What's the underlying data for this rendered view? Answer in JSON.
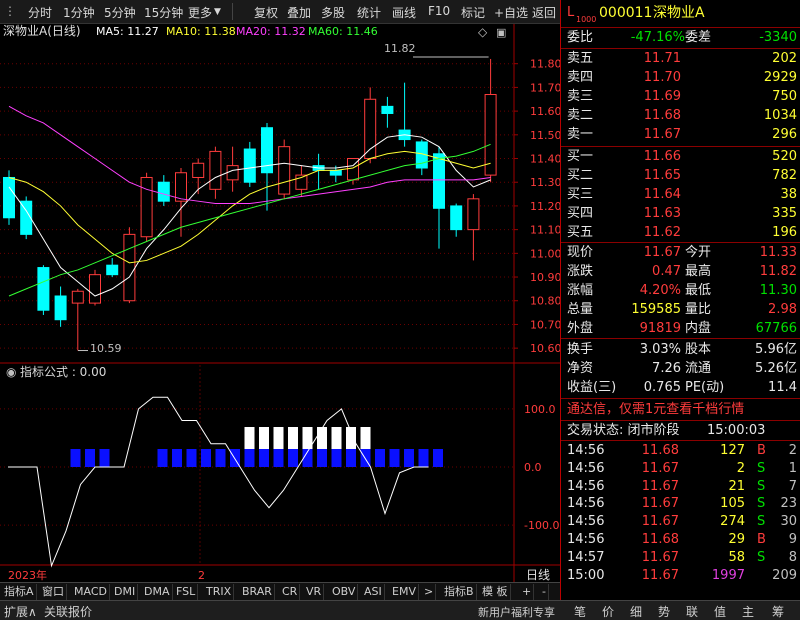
{
  "toolbar": {
    "items": [
      "分时",
      "1分钟",
      "5分钟",
      "15分钟",
      "更多",
      "复权",
      "叠加",
      "多股",
      "统计",
      "画线",
      "F10",
      "标记",
      "+自选",
      "返回"
    ]
  },
  "chart": {
    "title": "深物业A(日线)",
    "ma": [
      {
        "label": "MA5: 11.27",
        "color": "#ffffff"
      },
      {
        "label": "MA10: 11.38",
        "color": "#ffff33"
      },
      {
        "label": "MA20: 11.32",
        "color": "#ff40ff"
      },
      {
        "label": "MA60: 11.46",
        "color": "#33ff33"
      }
    ],
    "high_label": "11.82",
    "low_label": "10.59",
    "indicator_title": "指标公式 : 0.00",
    "date_label": "2023年",
    "date_mark": "2",
    "axis_label": "日线"
  },
  "chart_data": [
    {
      "type": "candlestick",
      "title": "深物业A(日线)",
      "ylim": [
        10.55,
        11.9
      ],
      "y_ticks": [
        11.8,
        11.7,
        11.6,
        11.5,
        11.4,
        11.3,
        11.2,
        11.1,
        11.0,
        10.9,
        10.8,
        10.7,
        10.6
      ],
      "candles": [
        {
          "o": 11.32,
          "h": 11.35,
          "l": 11.12,
          "c": 11.15
        },
        {
          "o": 11.22,
          "h": 11.24,
          "l": 11.06,
          "c": 11.08
        },
        {
          "o": 10.94,
          "h": 10.95,
          "l": 10.74,
          "c": 10.76
        },
        {
          "o": 10.82,
          "h": 10.86,
          "l": 10.69,
          "c": 10.72
        },
        {
          "o": 10.79,
          "h": 10.85,
          "l": 10.59,
          "c": 10.84
        },
        {
          "o": 10.79,
          "h": 10.93,
          "l": 10.78,
          "c": 10.91
        },
        {
          "o": 10.95,
          "h": 10.98,
          "l": 10.9,
          "c": 10.91
        },
        {
          "o": 10.8,
          "h": 11.11,
          "l": 10.79,
          "c": 11.08
        },
        {
          "o": 11.07,
          "h": 11.34,
          "l": 11.05,
          "c": 11.32
        },
        {
          "o": 11.3,
          "h": 11.33,
          "l": 11.2,
          "c": 11.22
        },
        {
          "o": 11.22,
          "h": 11.36,
          "l": 11.07,
          "c": 11.34
        },
        {
          "o": 11.32,
          "h": 11.4,
          "l": 11.25,
          "c": 11.38
        },
        {
          "o": 11.27,
          "h": 11.45,
          "l": 11.23,
          "c": 11.43
        },
        {
          "o": 11.31,
          "h": 11.45,
          "l": 11.26,
          "c": 11.37
        },
        {
          "o": 11.44,
          "h": 11.47,
          "l": 11.28,
          "c": 11.3
        },
        {
          "o": 11.53,
          "h": 11.55,
          "l": 11.18,
          "c": 11.34
        },
        {
          "o": 11.25,
          "h": 11.48,
          "l": 11.23,
          "c": 11.45
        },
        {
          "o": 11.27,
          "h": 11.37,
          "l": 11.24,
          "c": 11.33
        },
        {
          "o": 11.37,
          "h": 11.42,
          "l": 11.27,
          "c": 11.35
        },
        {
          "o": 11.35,
          "h": 11.37,
          "l": 11.3,
          "c": 11.33
        },
        {
          "o": 11.31,
          "h": 11.4,
          "l": 11.29,
          "c": 11.4
        },
        {
          "o": 11.4,
          "h": 11.7,
          "l": 11.38,
          "c": 11.65
        },
        {
          "o": 11.62,
          "h": 11.66,
          "l": 11.53,
          "c": 11.59
        },
        {
          "o": 11.52,
          "h": 11.72,
          "l": 11.45,
          "c": 11.48
        },
        {
          "o": 11.47,
          "h": 11.48,
          "l": 11.33,
          "c": 11.36
        },
        {
          "o": 11.42,
          "h": 11.45,
          "l": 11.02,
          "c": 11.19
        },
        {
          "o": 11.2,
          "h": 11.21,
          "l": 11.07,
          "c": 11.1
        },
        {
          "o": 11.1,
          "h": 11.25,
          "l": 10.97,
          "c": 11.23
        },
        {
          "o": 11.33,
          "h": 11.82,
          "l": 11.3,
          "c": 11.67
        }
      ],
      "ma_series": [
        {
          "name": "MA5",
          "color": "#ffffff",
          "values": [
            11.28,
            11.18,
            11.06,
            10.94,
            10.88,
            10.82,
            10.85,
            10.9,
            11.02,
            11.1,
            11.19,
            11.27,
            11.32,
            11.35,
            11.36,
            11.37,
            11.38,
            11.37,
            11.36,
            11.36,
            11.37,
            11.44,
            11.49,
            11.5,
            11.49,
            11.45,
            11.35,
            11.28,
            11.31
          ]
        },
        {
          "name": "MA10",
          "color": "#ffff33",
          "values": [
            11.32,
            11.3,
            11.26,
            11.2,
            11.12,
            11.06,
            11.0,
            10.96,
            10.97,
            11.0,
            11.03,
            11.08,
            11.14,
            11.2,
            11.25,
            11.28,
            11.3,
            11.32,
            11.35,
            11.35,
            11.36,
            11.4,
            11.42,
            11.43,
            11.42,
            11.4,
            11.38,
            11.36,
            11.38
          ]
        },
        {
          "name": "MA20",
          "color": "#ff40ff",
          "values": [
            11.62,
            11.58,
            11.55,
            11.5,
            11.45,
            11.4,
            11.35,
            11.3,
            11.27,
            11.25,
            11.23,
            11.22,
            11.21,
            11.21,
            11.21,
            11.22,
            11.23,
            11.24,
            11.25,
            11.26,
            11.27,
            11.28,
            11.3,
            11.31,
            11.31,
            11.31,
            11.31,
            11.31,
            11.32
          ]
        },
        {
          "name": "MA60",
          "color": "#33ff33",
          "values": [
            10.82,
            10.85,
            10.88,
            10.91,
            10.93,
            10.96,
            10.99,
            11.02,
            11.05,
            11.08,
            11.11,
            11.13,
            11.15,
            11.17,
            11.19,
            11.21,
            11.23,
            11.25,
            11.27,
            11.29,
            11.31,
            11.33,
            11.35,
            11.37,
            11.38,
            11.4,
            11.41,
            11.43,
            11.46
          ]
        }
      ]
    },
    {
      "type": "bar",
      "title": "指标公式 : 0.00",
      "ylim": [
        -160,
        160
      ],
      "y_ticks": [
        100.0,
        0.0,
        -100.0
      ],
      "line": [
        0,
        0,
        0,
        -170,
        -110,
        -30,
        0,
        0,
        0,
        100,
        120,
        120,
        80,
        80,
        40,
        40,
        0,
        -40,
        -70,
        -40,
        0,
        40,
        80,
        100,
        40,
        0,
        -80,
        -10,
        0,
        0
      ],
      "blue_bars": [
        1,
        2,
        3,
        7,
        8,
        9,
        10,
        11,
        12,
        13,
        14,
        15,
        16,
        17,
        18,
        19,
        20,
        21,
        22,
        23,
        24,
        25,
        26
      ],
      "white_bars": [
        13,
        14,
        15,
        16,
        17,
        18,
        19,
        20,
        21
      ]
    }
  ],
  "quote": {
    "code_prefix": "L",
    "code_sub": "1000",
    "code": "000011",
    "name": "深物业A",
    "webi_label": "委比",
    "webi_value": "-47.16%",
    "weicha_label": "委差",
    "weicha_value": "-3340",
    "asks": [
      {
        "label": "卖五",
        "price": "11.71",
        "vol": "202"
      },
      {
        "label": "卖四",
        "price": "11.70",
        "vol": "2929"
      },
      {
        "label": "卖三",
        "price": "11.69",
        "vol": "750"
      },
      {
        "label": "卖二",
        "price": "11.68",
        "vol": "1034"
      },
      {
        "label": "卖一",
        "price": "11.67",
        "vol": "296"
      }
    ],
    "bids": [
      {
        "label": "买一",
        "price": "11.66",
        "vol": "520"
      },
      {
        "label": "买二",
        "price": "11.65",
        "vol": "782"
      },
      {
        "label": "买三",
        "price": "11.64",
        "vol": "38"
      },
      {
        "label": "买四",
        "price": "11.63",
        "vol": "335"
      },
      {
        "label": "买五",
        "price": "11.62",
        "vol": "196"
      }
    ],
    "stats": [
      {
        "l1": "现价",
        "v1": "11.67",
        "l2": "今开",
        "v2": "11.33"
      },
      {
        "l1": "涨跌",
        "v1": "0.47",
        "l2": "最高",
        "v2": "11.82"
      },
      {
        "l1": "涨幅",
        "v1": "4.20%",
        "l2": "最低",
        "v2": "11.30"
      },
      {
        "l1": "总量",
        "v1": "159585",
        "l2": "量比",
        "v2": "2.98"
      },
      {
        "l1": "外盘",
        "v1": "91819",
        "l2": "内盘",
        "v2": "67766"
      }
    ],
    "fund": [
      {
        "l1": "换手",
        "v1": "3.03%",
        "l2": "股本",
        "v2": "5.96亿"
      },
      {
        "l1": "净资",
        "v1": "7.26",
        "l2": "流通",
        "v2": "5.26亿"
      },
      {
        "l1": "收益(三)",
        "v1": "0.765",
        "l2": "PE(动)",
        "v2": "11.4"
      }
    ],
    "promo": "通达信，仅需1元查看千档行情",
    "trade_status_label": "交易状态: 闭市阶段",
    "trade_status_time": "15:00:03",
    "ticks": [
      {
        "time": "14:56",
        "price": "11.68",
        "vol": "127",
        "bs": "B",
        "n": "2"
      },
      {
        "time": "14:56",
        "price": "11.67",
        "vol": "2",
        "bs": "S",
        "n": "1"
      },
      {
        "time": "14:56",
        "price": "11.67",
        "vol": "21",
        "bs": "S",
        "n": "7"
      },
      {
        "time": "14:56",
        "price": "11.67",
        "vol": "105",
        "bs": "S",
        "n": "23"
      },
      {
        "time": "14:56",
        "price": "11.67",
        "vol": "274",
        "bs": "S",
        "n": "30"
      },
      {
        "time": "14:56",
        "price": "11.68",
        "vol": "29",
        "bs": "B",
        "n": "9"
      },
      {
        "time": "14:57",
        "price": "11.67",
        "vol": "58",
        "bs": "S",
        "n": "8"
      },
      {
        "time": "15:00",
        "price": "11.67",
        "vol": "1997",
        "bs": "",
        "n": "209"
      }
    ]
  },
  "bottom_tabs": [
    "指标A",
    "窗口",
    "MACD",
    "DMI",
    "DMA",
    "FSL",
    "TRIX",
    "BRAR",
    "CR",
    "VR",
    "OBV",
    "ASI",
    "EMV",
    ">",
    "指标B",
    "模 板",
    "+",
    "-"
  ],
  "status": {
    "left": [
      "扩展∧",
      "关联报价"
    ],
    "promo": "新用户福利专享",
    "tabs": [
      "笔",
      "价",
      "细",
      "势",
      "联",
      "值",
      "主",
      "筹"
    ]
  },
  "colors": {
    "up": "#ff3c3c",
    "down": "#00ffff",
    "grid": "#8b0000",
    "axis_text": "#ff3c3c"
  }
}
